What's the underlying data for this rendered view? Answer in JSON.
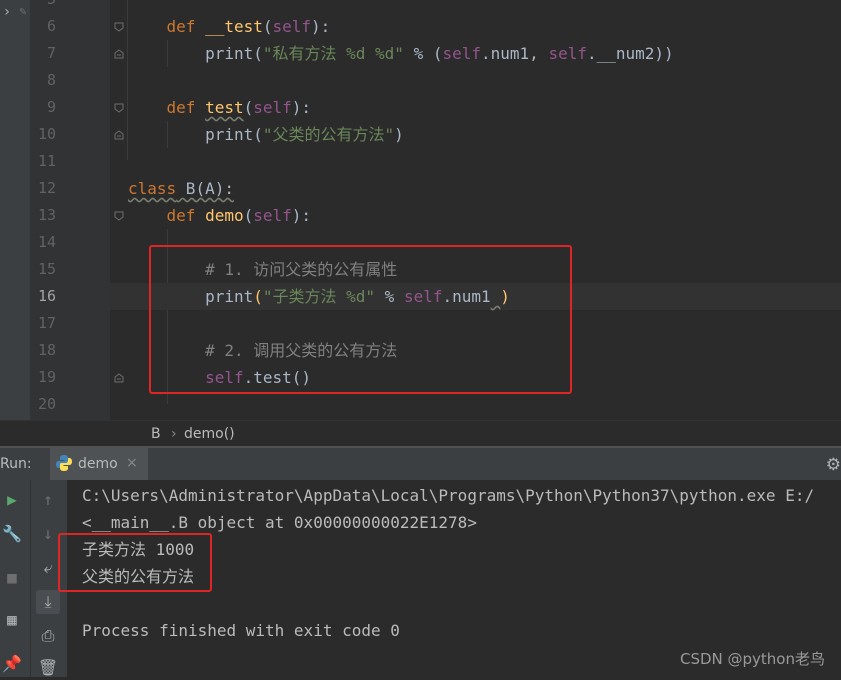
{
  "editor": {
    "line_numbers": [
      "5",
      "6",
      "7",
      "8",
      "9",
      "10",
      "11",
      "12",
      "13",
      "14",
      "15",
      "16",
      "17",
      "18",
      "19",
      "20"
    ],
    "current_line": "16",
    "code": {
      "l6_def": "def ",
      "l6_name": "__test",
      "l6_paren_open": "(",
      "l6_self": "self",
      "l6_paren_close": "):",
      "l7_print": "print(",
      "l7_str": "\"私有方法 %d %d\"",
      "l7_mid": " % (",
      "l7_self1": "self",
      "l7_attr1": ".num1, ",
      "l7_self2": "self",
      "l7_attr2": ".__num2))",
      "l9_def": "def ",
      "l9_name": "test",
      "l9_paren_open": "(",
      "l9_self": "self",
      "l9_paren_close": "):",
      "l10_print": "print(",
      "l10_str": "\"父类的公有方法\"",
      "l10_close": ")",
      "l12_class": "class",
      "l12_rest": " B(A):",
      "l13_def": "def ",
      "l13_name": "demo",
      "l13_paren_open": "(",
      "l13_self": "self",
      "l13_paren_close": "):",
      "l15_comment": "# 1. 访问父类的公有属性",
      "l16_print": "print",
      "l16_paren": "(",
      "l16_str": "\"子类方法 %d\"",
      "l16_mid": " % ",
      "l16_self": "self",
      "l16_attr": ".num1",
      "l16_ws": " ",
      "l16_close": ")",
      "l18_comment": "# 2. 调用父类的公有方法",
      "l19_self": "self",
      "l19_rest": ".test()"
    }
  },
  "breadcrumb": {
    "class_name": "B",
    "sep": "›",
    "method_name": "demo()"
  },
  "run_panel": {
    "label": "Run:",
    "tab_label": "demo",
    "tab_close": "×",
    "output": [
      "C:\\Users\\Administrator\\AppData\\Local\\Programs\\Python\\Python37\\python.exe E:/",
      "<__main__.B object at 0x00000000022E1278>",
      "子类方法 1000",
      "父类的公有方法",
      "",
      "Process finished with exit code 0"
    ]
  },
  "watermark": "CSDN @python老鸟",
  "colors": {
    "keyword": "#cc7832",
    "function": "#ffc66d",
    "self": "#94558d",
    "string": "#6a8759",
    "comment": "#808080",
    "highlight": "#e02525"
  }
}
